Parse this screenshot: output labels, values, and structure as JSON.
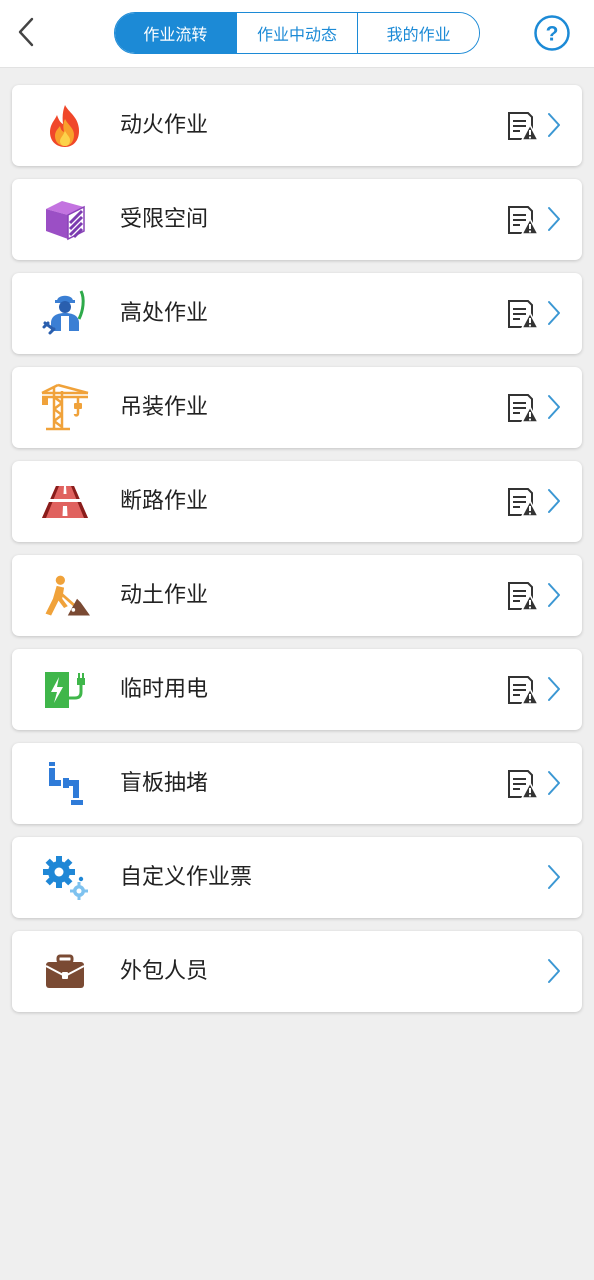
{
  "header": {
    "tabs": [
      {
        "label": "作业流转",
        "active": true
      },
      {
        "label": "作业中动态",
        "active": false
      },
      {
        "label": "我的作业",
        "active": false
      }
    ],
    "help_symbol": "?"
  },
  "items": [
    {
      "label": "动火作业",
      "icon": "fire-icon",
      "has_doc": true
    },
    {
      "label": "受限空间",
      "icon": "confined-space-cube-icon",
      "has_doc": true
    },
    {
      "label": "高处作业",
      "icon": "height-worker-icon",
      "has_doc": true
    },
    {
      "label": "吊装作业",
      "icon": "crane-icon",
      "has_doc": true
    },
    {
      "label": "断路作业",
      "icon": "road-icon",
      "has_doc": true
    },
    {
      "label": "动土作业",
      "icon": "digging-worker-icon",
      "has_doc": true
    },
    {
      "label": "临时用电",
      "icon": "electric-plug-icon",
      "has_doc": true
    },
    {
      "label": "盲板抽堵",
      "icon": "pipe-blind-icon",
      "has_doc": true
    },
    {
      "label": "自定义作业票",
      "icon": "gears-icon",
      "has_doc": false
    },
    {
      "label": "外包人员",
      "icon": "briefcase-icon",
      "has_doc": false
    }
  ],
  "colors": {
    "accent": "#1c8ad6",
    "background": "#efefef",
    "chevron": "#3b97d3"
  }
}
